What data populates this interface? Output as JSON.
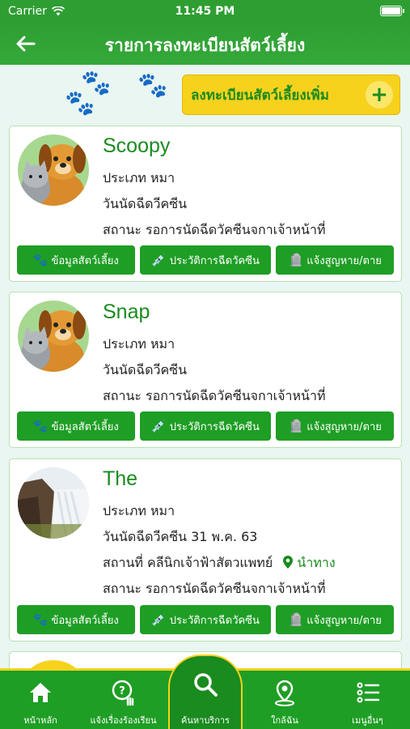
{
  "status": {
    "carrier": "Carrier",
    "time": "11:45 PM"
  },
  "nav": {
    "title": "รายการลงทะเบียนสัตว์เลี้ยง"
  },
  "add_button": {
    "label": "ลงทะเบียนสัตว์เลี้ยงเพิ่ม",
    "plus": "+"
  },
  "pets": [
    {
      "name": "Scoopy",
      "type": "ประเภท หมา",
      "date": "วันนัดฉีดวีคซีน",
      "status": "สถานะ รอการนัดฉีดวัคซีนจกาเจ้าหน้าที่"
    },
    {
      "name": "Snap",
      "type": "ประเภท หมา",
      "date": "วันนัดฉีดวีคซีน",
      "status": "สถานะ รอการนัดฉีดวัคซีนจกาเจ้าหน้าที่"
    },
    {
      "name": "The",
      "type": "ประเภท หมา",
      "date": "วันนัดฉีดวีคซีน 31 พ.ค. 63",
      "place": "สถานที่ คลีนิกเจ้าฟ้าสัตวแพทย์",
      "navigate": "นำทาง",
      "status": "สถานะ รอการนัดฉีดวัคซีนจกาเจ้าหน้าที่"
    }
  ],
  "actions": {
    "info": "ข้อมูลสัตว์เลี้ยง",
    "history": "ประวัติการฉีดวัคซีน",
    "report": "แจ้งสูญหาย/ตาย"
  },
  "tabs": [
    {
      "label": "หน้าหลัก",
      "icon": "home-icon"
    },
    {
      "label": "แจ้งเรื่องร้องเรียน",
      "icon": "complaint-icon"
    },
    {
      "label": "ค้นหาบริการ",
      "icon": "search-icon"
    },
    {
      "label": "ใกล้ฉัน",
      "icon": "location-pin-icon"
    },
    {
      "label": "เมนูอื่นๆ",
      "icon": "list-menu-icon"
    }
  ],
  "colors": {
    "primary": "#1e9e24",
    "accent": "#f7d21d",
    "background": "#e9f6f1"
  }
}
